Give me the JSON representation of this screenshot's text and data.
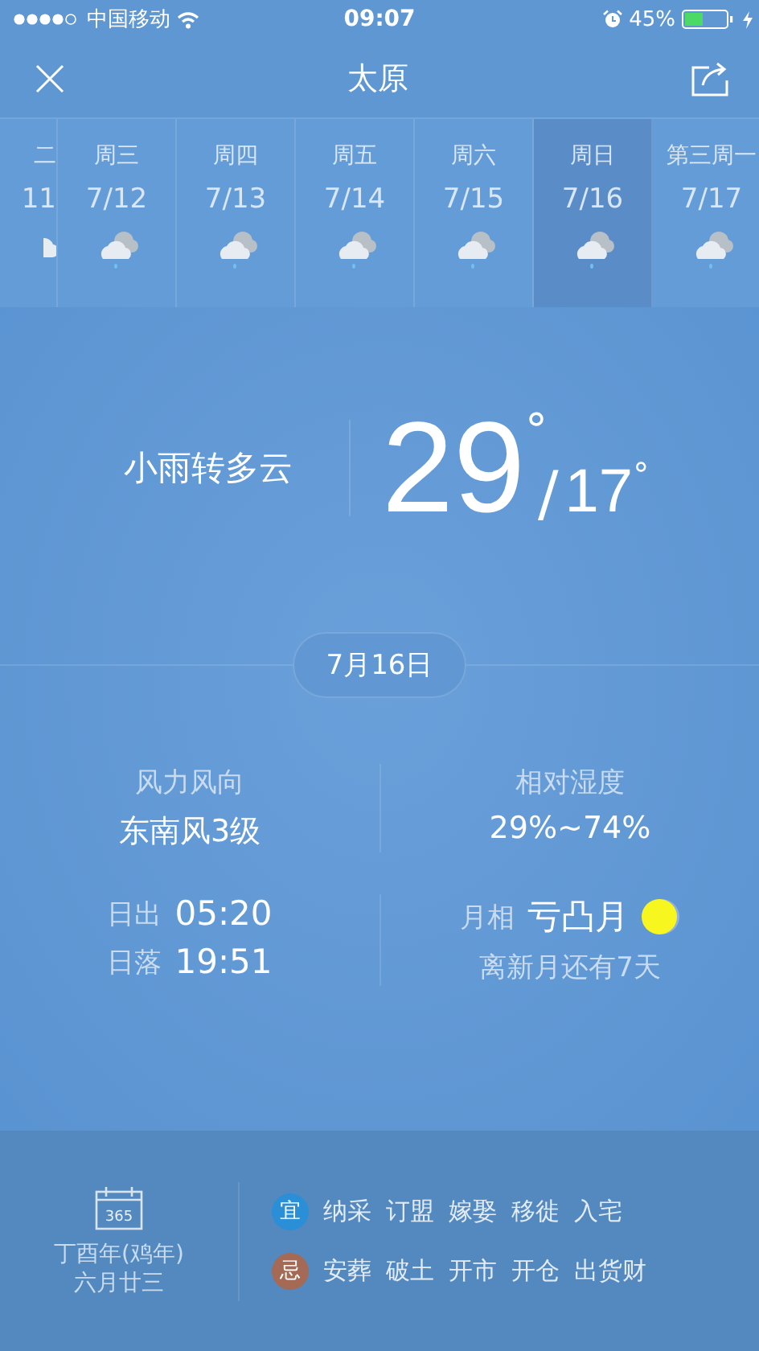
{
  "status_bar": {
    "carrier": "中国移动",
    "time": "09:07",
    "battery": "45%"
  },
  "header": {
    "title": "太原"
  },
  "days": [
    {
      "label": "二",
      "date": "11",
      "selected": false,
      "partial": true
    },
    {
      "label": "周三",
      "date": "7/12",
      "selected": false
    },
    {
      "label": "周四",
      "date": "7/13",
      "selected": false
    },
    {
      "label": "周五",
      "date": "7/14",
      "selected": false
    },
    {
      "label": "周六",
      "date": "7/15",
      "selected": false
    },
    {
      "label": "周日",
      "date": "7/16",
      "selected": true
    },
    {
      "label": "第三周一",
      "date": "7/17",
      "selected": false
    }
  ],
  "today": {
    "condition": "小雨转多云",
    "high": "29",
    "high_unit": "°",
    "separator": "/",
    "low": "17",
    "low_unit": "°",
    "date": "7月16日"
  },
  "details": [
    {
      "label": "风力风向",
      "value": "东南风3级"
    },
    {
      "label": "相对湿度",
      "value": "29%~74%"
    }
  ],
  "sun": [
    {
      "label": "日出",
      "value": "05:20"
    },
    {
      "label": "日落",
      "value": "19:51"
    }
  ],
  "moon": {
    "label": "月相",
    "phase": "亏凸月",
    "note": "离新月还有7天"
  },
  "almanac": {
    "year": "丁酉年(鸡年)",
    "lunar_date": "六月廿三",
    "calendar_number": "365",
    "rows": [
      {
        "tag": "宜",
        "color": "#2a8fd6",
        "items": [
          "纳采",
          "订盟",
          "嫁娶",
          "移徙",
          "入宅"
        ]
      },
      {
        "tag": "忌",
        "color": "#a46a55",
        "items": [
          "安葬",
          "破土",
          "开市",
          "开仓",
          "出货财"
        ]
      }
    ]
  }
}
